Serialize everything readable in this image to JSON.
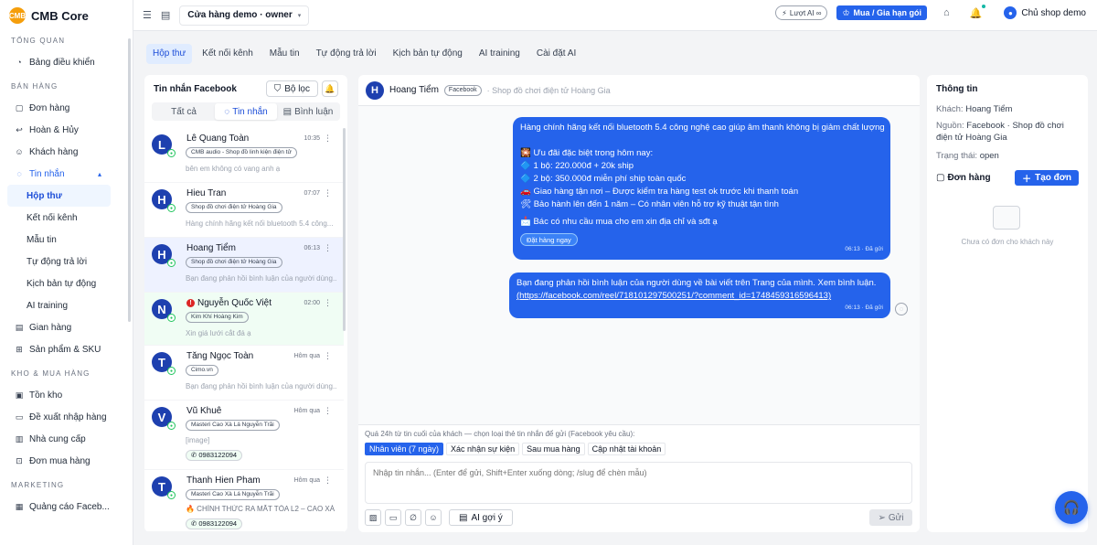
{
  "app": {
    "name": "CMB Core",
    "logo_text": "CMB"
  },
  "sidebar": {
    "sections": [
      {
        "title": "TỔNG QUAN",
        "items": [
          {
            "label": "Bảng điều khiển",
            "icon": "gauge-icon"
          }
        ]
      },
      {
        "title": "BÁN HÀNG",
        "items": [
          {
            "label": "Đơn hàng",
            "icon": "bag-icon"
          },
          {
            "label": "Hoàn & Hủy",
            "icon": "return-icon"
          },
          {
            "label": "Khách hàng",
            "icon": "users-icon"
          },
          {
            "label": "Tin nhắn",
            "icon": "chat-icon",
            "expanded": true,
            "children": [
              "Hộp thư",
              "Kết nối kênh",
              "Mẫu tin",
              "Tự động trả lời",
              "Kịch bản tự động",
              "AI training"
            ]
          },
          {
            "label": "Gian hàng",
            "icon": "store-icon"
          },
          {
            "label": "Sản phẩm & SKU",
            "icon": "grid-icon"
          }
        ]
      },
      {
        "title": "KHO & MUA HÀNG",
        "items": [
          {
            "label": "Tồn kho",
            "icon": "box-icon"
          },
          {
            "label": "Đề xuất nhập hàng",
            "icon": "truck-icon"
          },
          {
            "label": "Nhà cung cấp",
            "icon": "supplier-icon"
          },
          {
            "label": "Đơn mua hàng",
            "icon": "cart-icon"
          }
        ]
      },
      {
        "title": "MARKETING",
        "items": [
          {
            "label": "Quảng cáo Faceb...",
            "icon": "ads-icon"
          }
        ]
      }
    ]
  },
  "topbar": {
    "store": "Cửa hàng demo · owner",
    "ai_pill": "Lượt AI ∞",
    "buy_label": "Mua / Gia hạn gói",
    "user": "Chủ shop demo"
  },
  "tabs": [
    "Hộp thư",
    "Kết nối kênh",
    "Mẫu tin",
    "Tự động trả lời",
    "Kịch bản tự động",
    "AI training",
    "Cài đặt AI"
  ],
  "inbox": {
    "title": "Tin nhắn Facebook",
    "filter_label": "Bộ lọc",
    "segments": [
      "Tất cả",
      "Tin nhắn",
      "Bình luận"
    ],
    "conversations": [
      {
        "initial": "L",
        "name": "Lê Quang Toàn",
        "time": "10:35",
        "tag": "CMB audio - Shop đồ linh kiện điện tử",
        "preview": "bên em không có vang anh ạ",
        "phone": ""
      },
      {
        "initial": "H",
        "name": "Hieu Tran",
        "time": "07:07",
        "tag": "Shop đồ chơi điện tử Hoàng Gia",
        "preview": "Hàng chính hãng kết nối bluetooth 5.4 công...",
        "phone": ""
      },
      {
        "initial": "H",
        "name": "Hoang Tiểm",
        "time": "06:13",
        "tag": "Shop đồ chơi điện tử Hoàng Gia",
        "preview": "Bạn đang phản hồi bình luận của người dùng...",
        "phone": ""
      },
      {
        "initial": "N",
        "name": "Nguyễn Quốc Việt",
        "time": "02:00",
        "tag": "Kim Khí Hoàng Kim",
        "preview": "Xin giá lưới cắt đá ạ",
        "phone": ""
      },
      {
        "initial": "T",
        "name": "Tăng Ngọc Toàn",
        "time": "Hôm qua",
        "tag": "Cimo.vn",
        "preview": "Bạn đang phản hồi bình luận của người dùng...",
        "phone": ""
      },
      {
        "initial": "V",
        "name": "Vũ Khuê",
        "time": "Hôm qua",
        "tag": "Masteri Cao Xà Lá Nguyễn Trãi",
        "preview": "[image]",
        "phone": "0983122094"
      },
      {
        "initial": "T",
        "name": "Thanh Hien Pham",
        "time": "Hôm qua",
        "tag": "Masteri Cao Xà Lá Nguyễn Trãi",
        "preview": "🔥 CHÍNH THỨC RA MẮT TÒA L2 – CAO XÀ L...",
        "phone": "0983122094"
      }
    ]
  },
  "chat": {
    "name": "Hoang Tiểm",
    "source": "Facebook",
    "shop": "· Shop đồ chơi điện tử Hoàng Gia",
    "messages": [
      {
        "lines": [
          "Hàng chính hãng kết nối bluetooth 5.4 công nghệ cao giúp âm thanh không bị giảm chất lượng",
          "",
          "🎇 Ưu đãi đặc biệt trong hôm nay:",
          "🔷 1 bộ: 220.000đ + 20k ship",
          "🔷 2 bộ: 350.000đ miễn phí ship toàn quốc",
          "🚗 Giao hàng tận nơi – Được kiểm tra hàng test ok trước khi thanh toán",
          "🛠 Bảo hành lên đến 1 năm – Có nhân viên hỗ trợ kỹ thuật tận tình",
          "",
          "📩 Bác có nhu cầu mua cho em xin địa chỉ và sđt ạ"
        ],
        "button": "Đặt hàng ngay",
        "meta": "06:13 · Đã gửi"
      },
      {
        "text": "Bạn đang phản hồi bình luận của người dùng về bài viết trên Trang của mình. Xem bình luận.",
        "link": "(https://facebook.com/reel/718101297500251/?comment_id=1748459316596413)",
        "meta": "06:13 · Đã gửi"
      }
    ],
    "composer": {
      "note": "Quá 24h từ tin cuối của khách — chọn loại thẻ tin nhắn để gửi (Facebook yêu cầu):",
      "tags": [
        "Nhân viên (7 ngày)",
        "Xác nhận sự kiện",
        "Sau mua hàng",
        "Cập nhật tài khoản"
      ],
      "placeholder": "Nhập tin nhắn... (Enter để gửi, Shift+Enter xuống dòng; /slug để chèn mẫu)",
      "ai_label": "AI gợi ý",
      "send_label": "Gửi"
    }
  },
  "info": {
    "title": "Thông tin",
    "customer_label": "Khách:",
    "customer": "Hoang Tiểm",
    "source_label": "Nguồn:",
    "source": "Facebook · Shop đồ chơi điện tử Hoàng Gia",
    "status_label": "Trạng thái:",
    "status": "open",
    "orders_label": "Đơn hàng",
    "create_label": "Tạo đơn",
    "empty": "Chưa có đơn cho khách này"
  },
  "colors": {
    "primary": "#2563eb",
    "online": "#22c55e",
    "alert": "#dc2626"
  }
}
